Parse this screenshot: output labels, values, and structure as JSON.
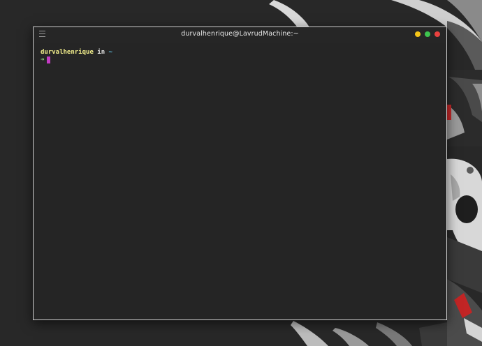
{
  "window": {
    "title": "durvalhenrique@LavrudMachine:~"
  },
  "prompt": {
    "user": "durvalhenrique",
    "in_word": "in",
    "path": "~",
    "arrow": "➜"
  },
  "icons": {
    "menu": "hamburger-menu-icon",
    "minimize": "minimize-dot-icon",
    "maximize": "maximize-dot-icon",
    "close": "close-dot-icon"
  },
  "colors": {
    "user": "#f3ef8c",
    "in_word": "#e6e6e6",
    "path": "#64c6e8",
    "arrow": "#9adf8a",
    "cursor": "#c43bc4",
    "minimize": "#f5c518",
    "maximize": "#3ec44f",
    "close": "#e9413f"
  }
}
